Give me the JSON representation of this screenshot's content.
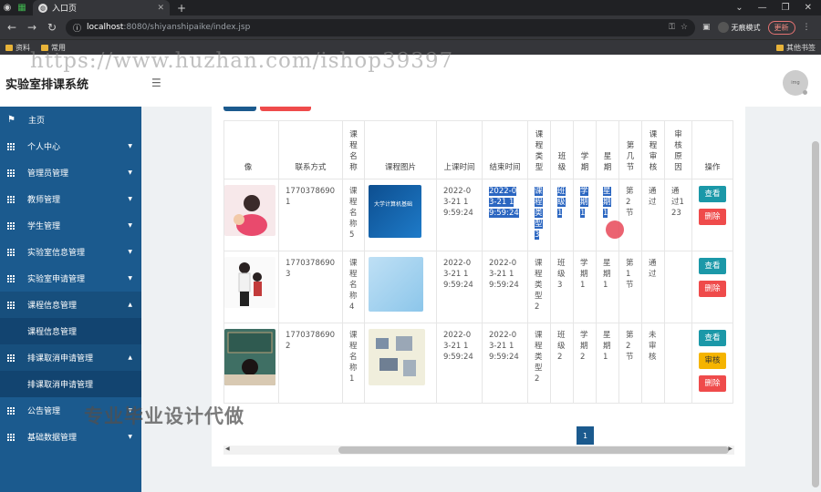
{
  "browser": {
    "tab_title": "入口页",
    "url_host": "localhost",
    "url_rest": ":8080/shiyanshipaike/index.jsp",
    "incognito_label": "无痕模式",
    "update_label": "更新",
    "bookmarks": [
      "资料",
      "常用"
    ],
    "bookmarks_right": "其他书签"
  },
  "app": {
    "title": "实验室排课系统",
    "watermark": "https://www.huzhan.com/ishop39397",
    "promo": "专业毕业设计代做"
  },
  "sidebar": {
    "items": [
      {
        "label": "主页"
      },
      {
        "label": "个人中心"
      },
      {
        "label": "管理员管理"
      },
      {
        "label": "教师管理"
      },
      {
        "label": "学生管理"
      },
      {
        "label": "实验室信息管理"
      },
      {
        "label": "实验室申请管理"
      },
      {
        "label": "课程信息管理"
      },
      {
        "label": "课程信息管理"
      },
      {
        "label": "排课取消申请管理"
      },
      {
        "label": "排课取消申请管理"
      },
      {
        "label": "公告管理"
      },
      {
        "label": "基础数据管理"
      }
    ]
  },
  "table": {
    "headers": [
      "像",
      "联系方式",
      "课程名称",
      "课程图片",
      "上课时间",
      "结束时间",
      "课程类型",
      "班级",
      "学期",
      "星期",
      "第几节",
      "课程审核",
      "审核原因",
      "操作"
    ],
    "rows": [
      {
        "phone": "17703786901",
        "course": "课程名称5",
        "start": "2022-03-21 19:59:24",
        "end": "2022-03-21 19:59:24",
        "type": "课程类型3",
        "class": "班级1",
        "term": "学期1",
        "week": "星期1",
        "period": "第2节",
        "audit": "通过",
        "reason": "通过123"
      },
      {
        "phone": "17703786903",
        "course": "课程名称4",
        "start": "2022-03-21 19:59:24",
        "end": "2022-03-21 19:59:24",
        "type": "课程类型2",
        "class": "班级3",
        "term": "学期1",
        "week": "星期1",
        "period": "第1节",
        "audit": "通过",
        "reason": ""
      },
      {
        "phone": "17703786902",
        "course": "课程名称1",
        "start": "2022-03-21 19:59:24",
        "end": "2022-03-21 19:59:24",
        "type": "课程类型2",
        "class": "班级2",
        "term": "学期2",
        "week": "星期1",
        "period": "第2节",
        "audit": "未审核",
        "reason": ""
      }
    ],
    "btn_view": "查看",
    "btn_delete": "删除",
    "btn_audit": "审核",
    "book_cover_text": "大学计算机基础"
  },
  "pager": {
    "page": "1"
  },
  "colors": {
    "sidebar": "#1b5a8e",
    "view": "#1b98a8",
    "delete": "#ef4b4b",
    "audit": "#f5b400",
    "selection": "#2b66c1"
  }
}
